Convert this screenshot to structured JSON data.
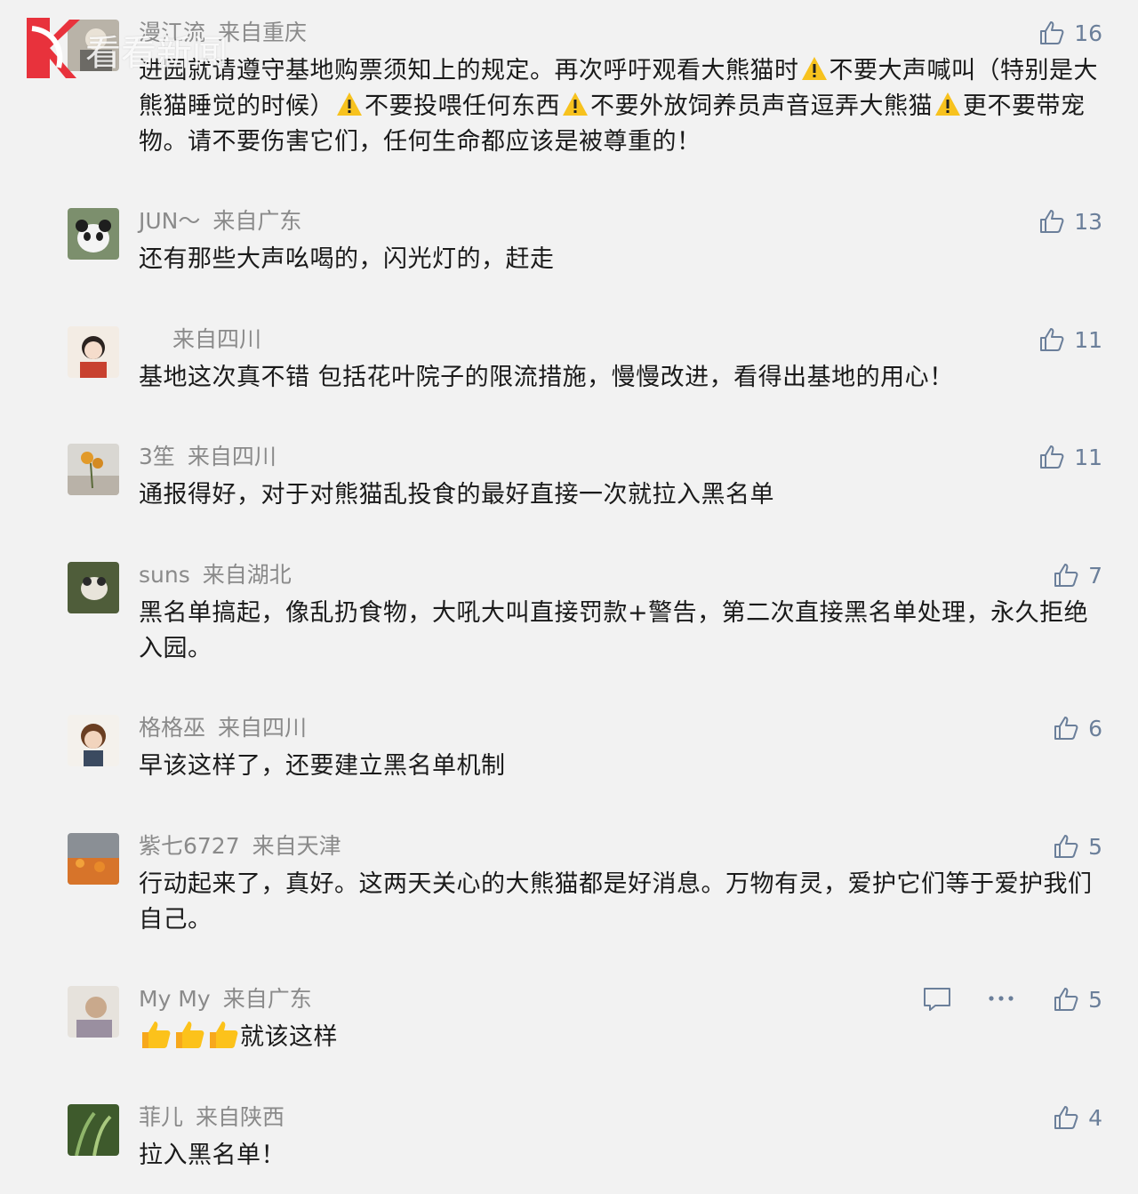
{
  "watermark": {
    "text": "看看新闻"
  },
  "comments": [
    {
      "user": "漫江流",
      "location": "来自重庆",
      "likes": "16",
      "segments": [
        "进园就请遵守基地购票须知上的规定。再次呼吁观看大熊猫时",
        "不要大声喊叫（特别是大熊猫睡觉的时候）",
        "不要投喂任何东西",
        "不要外放饲养员声音逗弄大熊猫",
        "更不要带宠物。请不要伤害它们，任何生命都应该是被尊重的！"
      ],
      "emoji": "warning-sign"
    },
    {
      "user": "JUN～",
      "location": "来自广东",
      "likes": "13",
      "text": "还有那些大声吆喝的，闪光灯的，赶走"
    },
    {
      "user": "",
      "location": "来自四川",
      "likes": "11",
      "text": "基地这次真不错 包括花叶院子的限流措施，慢慢改进，看得出基地的用心！"
    },
    {
      "user": "3笙",
      "location": "来自四川",
      "likes": "11",
      "text": "通报得好，对于对熊猫乱投食的最好直接一次就拉入黑名单"
    },
    {
      "user": "suns",
      "location": "来自湖北",
      "likes": "7",
      "text": "黑名单搞起，像乱扔食物，大吼大叫直接罚款+警告，第二次直接黑名单处理，永久拒绝入园。"
    },
    {
      "user": "格格巫",
      "location": "来自四川",
      "likes": "6",
      "text": "早该这样了，还要建立黑名单机制"
    },
    {
      "user": "紫七6727",
      "location": "来自天津",
      "likes": "5",
      "text": "行动起来了，真好。这两天关心的大熊猫都是好消息。万物有灵，爱护它们等于爱护我们自己。"
    },
    {
      "user": "My My",
      "location": "来自广东",
      "likes": "5",
      "text": "就该这样",
      "emoji": "thumbs-up x3"
    },
    {
      "user": "菲儿",
      "location": "来自陕西",
      "likes": "4",
      "text": "拉入黑名单！"
    }
  ],
  "colors": {
    "background": "#f2f2f2",
    "meta": "#8a8a8a",
    "text": "#1a1a1a",
    "like": "#6b7f9a",
    "brand": "#e8323c"
  },
  "icons": [
    "thumbs-up-outline-icon",
    "reply-icon",
    "more-icon",
    "warning-icon",
    "thumbs-up-emoji"
  ]
}
